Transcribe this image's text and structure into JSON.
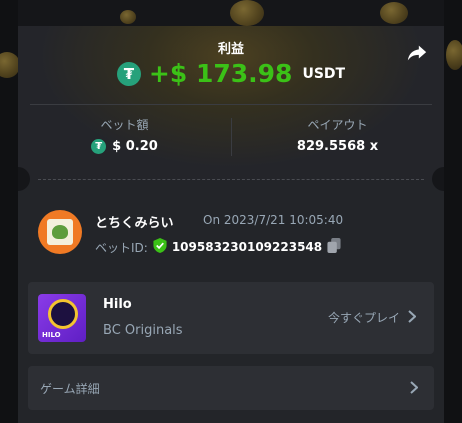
{
  "profit": {
    "title": "利益",
    "amount": "+$ 173.98",
    "currency": "USDT",
    "token_icon": "tether-icon",
    "accent": "#3bc117"
  },
  "bet": {
    "amount_label": "ベット額",
    "amount_value": "$ 0.20",
    "payout_label": "ペイアウト",
    "payout_value": "829.5568 x"
  },
  "user": {
    "name": "とちくみらい",
    "date": "On 2023/7/21 10:05:40",
    "bet_id_label": "ベットID:",
    "bet_id": "109583230109223548"
  },
  "game": {
    "name": "Hilo",
    "provider": "BC Originals",
    "thumb_label": "HILO",
    "play_label": "今すぐプレイ"
  },
  "details": {
    "label": "ゲーム詳細"
  },
  "colors": {
    "background": "#151619",
    "card": "#232529",
    "panel": "#2d2f34",
    "muted_text": "#98a7b5",
    "tether": "#26a17b",
    "verified": "#3bc117"
  }
}
